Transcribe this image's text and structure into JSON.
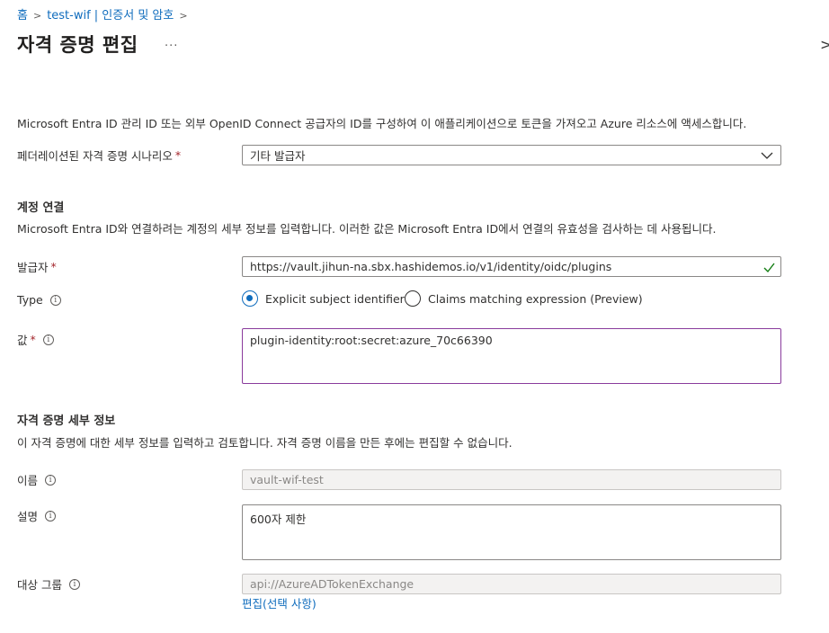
{
  "breadcrumb": {
    "home": "홈",
    "parent": "test-wif | 인증서 및 암호"
  },
  "page_title": "자격 증명 편집",
  "more_label": "...",
  "intro_text": "Microsoft Entra ID 관리 ID 또는 외부 OpenID Connect 공급자의 ID를 구성하여 이 애플리케이션으로 토큰을 가져오고 Azure 리소스에 액세스합니다.",
  "scenario": {
    "label": "페더레이션된 자격 증명 시나리오",
    "required_mark": "*",
    "selected": "기타 발급자"
  },
  "account": {
    "title": "계정 연결",
    "description": "Microsoft Entra ID와 연결하려는 계정의 세부 정보를 입력합니다. 이러한 값은 Microsoft Entra ID에서 연결의 유효성을 검사하는 데 사용됩니다.",
    "issuer_label": "발급자",
    "issuer_required": "*",
    "issuer_value": "https://vault.jihun-na.sbx.hashidemos.io/v1/identity/oidc/plugins",
    "type_label": "Type",
    "type_options": [
      "Explicit subject identifier",
      "Claims matching expression (Preview)"
    ],
    "type_selected_index": 0,
    "value_label": "값",
    "value_required": "*",
    "value_value": "plugin-identity:root:secret:azure_70c66390"
  },
  "details": {
    "title": "자격 증명 세부 정보",
    "description": "이 자격 증명에 대한 세부 정보를 입력하고 검토합니다. 자격 증명 이름을 만든 후에는 편집할 수 없습니다.",
    "name_label": "이름",
    "name_value": "vault-wif-test",
    "desc_label": "설명",
    "desc_value": "600자 제한",
    "audience_label": "대상 그룹",
    "audience_value": "api://AzureADTokenExchange",
    "edit_link": "편집(선택 사항)"
  },
  "icons": {
    "info": "info-icon",
    "check": "check-icon",
    "chevron": "chevron-down-icon"
  },
  "colors": {
    "link": "#0f6cbd",
    "required": "#a4262c",
    "check": "#107c10",
    "focus_border": "#8a3b9c"
  }
}
